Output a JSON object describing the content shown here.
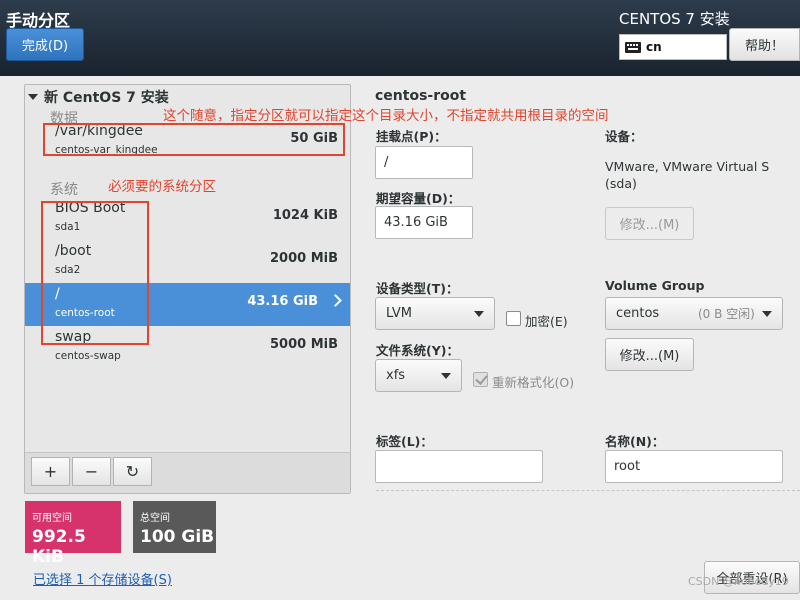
{
  "header": {
    "page_title": "手动分区",
    "done_label": "完成(D)",
    "product_title": "CENTOS 7 安装",
    "keyboard_layout": "cn",
    "help_label": "帮助！"
  },
  "tree": {
    "root_label": "新 CentOS 7 安装",
    "groups": [
      {
        "label": "数据",
        "partitions": [
          {
            "name": "/var/kingdee",
            "device": "centos-var_kingdee",
            "size": "50 GiB"
          }
        ]
      },
      {
        "label": "系统",
        "partitions": [
          {
            "name": "BIOS Boot",
            "device": "sda1",
            "size": "1024 KiB"
          },
          {
            "name": "/boot",
            "device": "sda2",
            "size": "2000 MiB"
          },
          {
            "name": "/",
            "device": "centos-root",
            "size": "43.16 GiB",
            "selected": true
          },
          {
            "name": "swap",
            "device": "centos-swap",
            "size": "5000 MiB"
          }
        ]
      }
    ],
    "toolbar": {
      "add": "+",
      "remove": "−",
      "refresh": "↻"
    }
  },
  "space": {
    "available_label": "可用空间",
    "available_value": "992.5 KiB",
    "available_color": "#d6336c",
    "total_label": "总空间",
    "total_value": "100 GiB",
    "total_color": "#595959"
  },
  "storage_link": "已选择 1 个存储设备(S)",
  "details": {
    "title": "centos-root",
    "mount_point_label": "挂载点(P)：",
    "mount_point_value": "/",
    "capacity_label": "期望容量(D)：",
    "capacity_value": "43.16 GiB",
    "device_label": "设备：",
    "device_value": "VMware, VMware Virtual S",
    "device_value2": "(sda)",
    "modify_label": "修改...(M)",
    "device_type_label": "设备类型(T)：",
    "device_type_value": "LVM",
    "encrypt_label": "加密(E)",
    "volume_group_label": "Volume Group",
    "volume_group_value": "centos",
    "volume_group_free": "(0 B 空闲)",
    "vg_modify_label": "修改...(M)",
    "filesystem_label": "文件系统(Y)：",
    "filesystem_value": "xfs",
    "reformat_label": "重新格式化(O)",
    "tag_label": "标签(L)：",
    "tag_value": "",
    "name_label": "名称(N)：",
    "name_value": "root",
    "reset_all_label": "全部重设(R)"
  },
  "annotations": {
    "note_data": "这个随意，指定分区就可以指定这个目录大小，不指定就共用根目录的空间",
    "note_system": "必须要的系统分区",
    "color": "#e0452e"
  },
  "watermark": "CSDN @nobody19"
}
